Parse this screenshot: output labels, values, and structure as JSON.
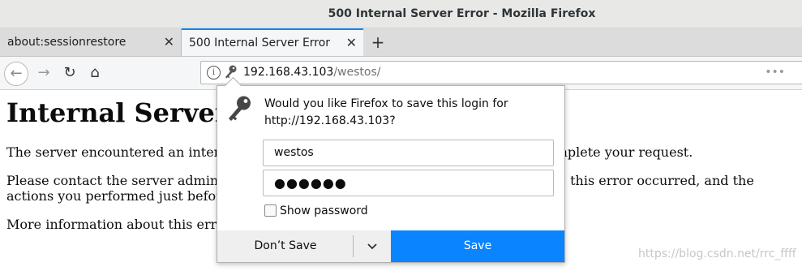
{
  "window": {
    "title": "500 Internal Server Error - Mozilla Firefox"
  },
  "tabs": [
    {
      "label": "about:sessionrestore",
      "close": "✕"
    },
    {
      "label": "500 Internal Server Error",
      "close": "✕"
    }
  ],
  "new_tab": "+",
  "nav": {
    "back": "←",
    "forward": "→",
    "reload": "↻",
    "home": "⌂"
  },
  "urlbar": {
    "info": "i",
    "host": "192.168.43.103",
    "path": "/westos/",
    "more": "•••"
  },
  "page": {
    "heading": "Internal Server Error",
    "p1": "The server encountered an internal error or misconfiguration and was unable to complete your request.",
    "p2": "Please contact the server administrator at root@localhost to inform them of the time this error occurred, and the actions you performed just before this error.",
    "p3": "More information about this error may be available in the server error log."
  },
  "login_popup": {
    "message_line1": "Would you like Firefox to save this login for",
    "message_line2": "http://192.168.43.103?",
    "username_value": "westos",
    "password_value": "●●●●●●",
    "show_password_label": "Show password",
    "dont_save_label": "Don’t Save",
    "save_label": "Save"
  },
  "watermark": "https://blog.csdn.net/rrc_ffff",
  "colors": {
    "accent": "#0a84ff",
    "titlebar": "#e8e8e7",
    "tabbar": "#dcdcdc"
  }
}
